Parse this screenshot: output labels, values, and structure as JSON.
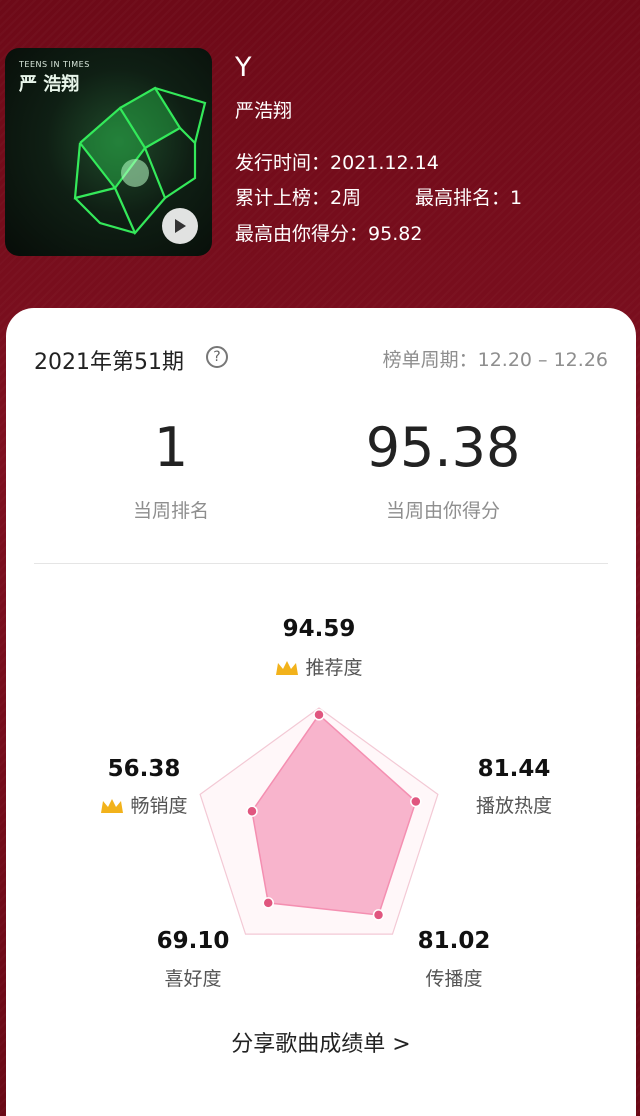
{
  "song": {
    "cover_text_top": "TEENS IN TIMES",
    "cover_text_name": "严 浩翔",
    "title": "Y",
    "artist": "严浩翔",
    "release_label": "发行时间：",
    "release_date": "2021.12.14",
    "weeks_label": "累计上榜：",
    "weeks_value": "2周",
    "peak_label": "最高排名：",
    "peak_value": "1",
    "best_score_label": "最高由你得分：",
    "best_score_value": "95.82"
  },
  "card": {
    "period": "2021年第51期",
    "help_icon": "?",
    "cycle_label": "榜单周期：",
    "cycle_value": "12.20 – 12.26",
    "rank_value": "1",
    "rank_label": "当周排名",
    "score_value": "95.38",
    "score_label": "当周由你得分",
    "share_label": "分享歌曲成绩单",
    "share_chevron": ">"
  },
  "radar": {
    "dimensions": [
      {
        "name": "推荐度",
        "value": 94.59,
        "display": "94.59",
        "crown": true
      },
      {
        "name": "播放热度",
        "value": 81.44,
        "display": "81.44",
        "crown": false
      },
      {
        "name": "传播度",
        "value": 81.02,
        "display": "81.02",
        "crown": false
      },
      {
        "name": "喜好度",
        "value": 69.1,
        "display": "69.10",
        "crown": false
      },
      {
        "name": "畅销度",
        "value": 56.38,
        "display": "56.38",
        "crown": true
      }
    ],
    "max": 100,
    "fill_color": "#f7a8c4",
    "point_color": "#e0567f"
  },
  "colors": {
    "background": "#7a0d1c",
    "crown": "#f2b21b"
  }
}
